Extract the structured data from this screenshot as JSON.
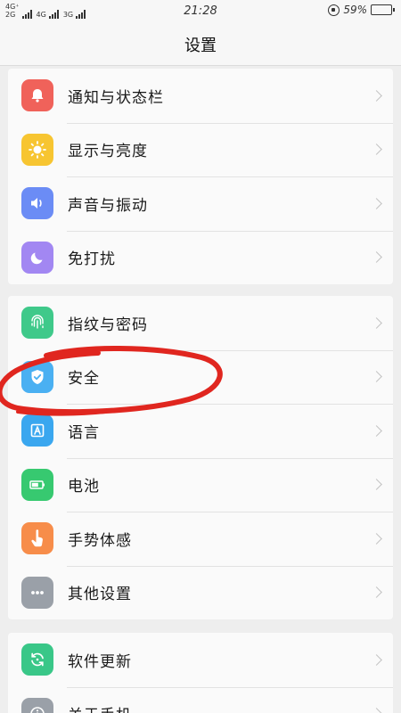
{
  "status_bar": {
    "network_1": "4G⁺",
    "network_2": "4G",
    "network_3": "3G",
    "carrier_small_1": "2G",
    "time": "21:28",
    "battery_percent": "59%",
    "battery_level": 0.59
  },
  "header": {
    "title": "设置"
  },
  "groups": [
    {
      "items": [
        {
          "label": "通知与状态栏",
          "icon": "bell-icon",
          "color": "#f0625a"
        },
        {
          "label": "显示与亮度",
          "icon": "sun-icon",
          "color": "#f7c531"
        },
        {
          "label": "声音与振动",
          "icon": "speaker-icon",
          "color": "#6b8cf5"
        },
        {
          "label": "免打扰",
          "icon": "moon-icon",
          "color": "#a287f2"
        }
      ]
    },
    {
      "items": [
        {
          "label": "指纹与密码",
          "icon": "fingerprint-icon",
          "color": "#3fc98a"
        },
        {
          "label": "安全",
          "icon": "shield-icon",
          "color": "#4ab0f2"
        },
        {
          "label": "语言",
          "icon": "language-icon",
          "color": "#3aa7ef"
        },
        {
          "label": "电池",
          "icon": "battery-icon",
          "color": "#37c970"
        },
        {
          "label": "手势体感",
          "icon": "hand-icon",
          "color": "#f78d4a"
        },
        {
          "label": "其他设置",
          "icon": "more-icon",
          "color": "#9aa0a8"
        }
      ]
    },
    {
      "items": [
        {
          "label": "软件更新",
          "icon": "update-icon",
          "color": "#39c788"
        },
        {
          "label": "关于手机",
          "icon": "info-icon",
          "color": "#9aa0a8"
        }
      ]
    }
  ],
  "annotation": {
    "color": "#e0261f"
  }
}
